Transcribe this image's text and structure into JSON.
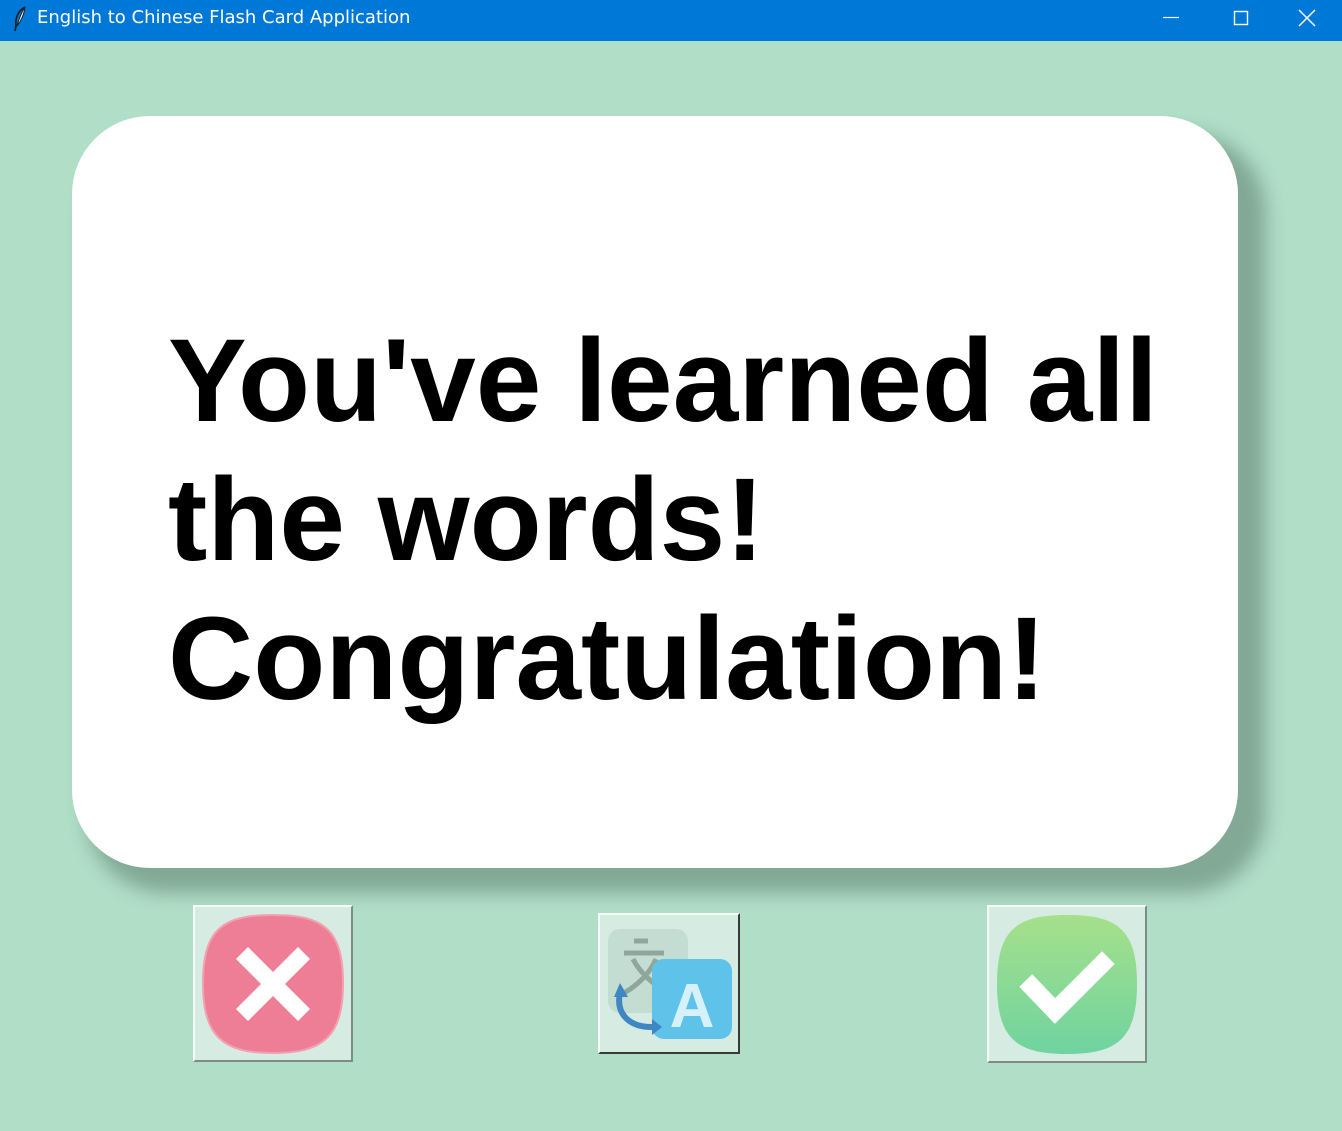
{
  "window": {
    "title": "English to Chinese Flash Card Application",
    "icon": "feather-icon",
    "controls": [
      "minimize-icon",
      "maximize-icon",
      "close-icon"
    ]
  },
  "card": {
    "text": "You've learned all\nthe words!\nCongratulation!"
  },
  "buttons": {
    "wrong": {
      "icon": "cross-icon",
      "color": "#ee7e96"
    },
    "translate": {
      "icon": "translate-icon",
      "color": "#5fc2e8"
    },
    "right": {
      "icon": "checkmark-icon",
      "color": "#8fdc8c"
    }
  },
  "colors": {
    "background": "#b1dec7",
    "titlebar": "#0078d7",
    "card": "#ffffff"
  }
}
